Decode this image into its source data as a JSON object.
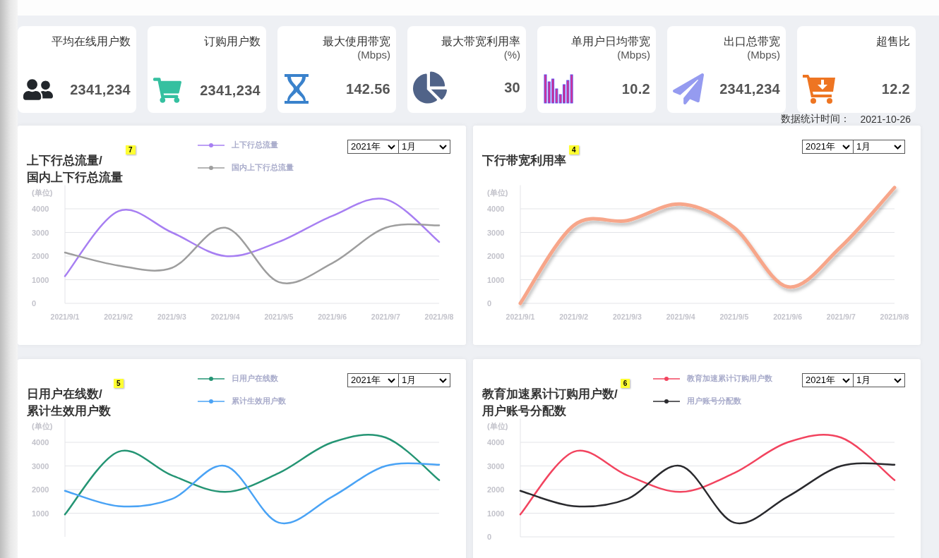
{
  "stats": [
    {
      "title": "平均在线用户数",
      "value": "2341,234"
    },
    {
      "title": "订购用户数",
      "value": "2341,234"
    },
    {
      "title": "最大使用带宽",
      "unit": "(Mbps)",
      "value": "142.56"
    },
    {
      "title": "最大带宽利用率",
      "unit": "(%)",
      "value": "30"
    },
    {
      "title": "单用户日均带宽",
      "unit": "(Mbps)",
      "value": "10.2"
    },
    {
      "title": "出口总带宽",
      "unit": "(Mbps)",
      "value": "2341,234"
    },
    {
      "title": "超售比",
      "value": "12.2"
    }
  ],
  "stat_time": {
    "label": "数据统计时间：",
    "value": "2021-10-26"
  },
  "charts": [
    {
      "title": [
        "上下行总流量/",
        "国内上下行总流量"
      ],
      "badge": "7",
      "year": "2021年",
      "month": "1月",
      "unit": "(单位)",
      "chart_data": {
        "type": "line",
        "grid": true,
        "categories": [
          "2021/9/1",
          "2021/9/2",
          "2021/9/3",
          "2021/9/4",
          "2021/9/5",
          "2021/9/6",
          "2021/9/7",
          "2021/9/8"
        ],
        "ylim": [
          0,
          5000
        ],
        "yticks": [
          0,
          1000,
          2000,
          3000,
          4000
        ],
        "series": [
          {
            "name": "上下行总流量",
            "color": "#a77ff2",
            "values": [
              1150,
              3900,
              3000,
              2000,
              2600,
              3700,
              4400,
              2600
            ]
          },
          {
            "name": "国内上下行总流量",
            "color": "#9e9e9e",
            "values": [
              2150,
              1600,
              1500,
              3200,
              900,
              1700,
              3200,
              3300
            ]
          }
        ]
      }
    },
    {
      "title": [
        "下行带宽利用率"
      ],
      "badge": "4",
      "year": "2021年",
      "month": "1月",
      "unit": "(单位)",
      "chart_data": {
        "type": "line",
        "grid": true,
        "categories": [
          "2021/9/1",
          "2021/9/2",
          "2021/9/3",
          "2021/9/4",
          "2021/9/5",
          "2021/9/6",
          "2021/9/7",
          "2021/9/8"
        ],
        "ylim": [
          0,
          5000
        ],
        "yticks": [
          0,
          1000,
          2000,
          3000,
          4000
        ],
        "series": [
          {
            "color": "#f7a68a",
            "values": [
              0,
              3300,
              3500,
              4200,
              3200,
              700,
              2400,
              4900
            ]
          }
        ]
      }
    },
    {
      "title": [
        "日用户在线数/",
        "累计生效用户数"
      ],
      "badge": "5",
      "year": "2021年",
      "month": "1月",
      "unit": "(单位)",
      "chart_data": {
        "type": "line",
        "grid": true,
        "ylim": [
          0,
          5000
        ],
        "yticks": [
          1000,
          2000,
          3000,
          4000
        ],
        "series": [
          {
            "name": "日用户在线数",
            "color": "#259574",
            "values": [
              950,
              3600,
              2600,
              1900,
              2700,
              4000,
              4200,
              2400
            ]
          },
          {
            "name": "累计生效用户数",
            "color": "#4aa3f5",
            "values": [
              1950,
              1300,
              1600,
              3000,
              600,
              1700,
              3000,
              3050
            ]
          }
        ]
      }
    },
    {
      "title": [
        "教育加速累计订购用户数/",
        "用户账号分配数"
      ],
      "badge": "6",
      "year": "2021年",
      "month": "1月",
      "unit": "(单位)",
      "chart_data": {
        "type": "line",
        "grid": true,
        "ylim": [
          0,
          5000
        ],
        "yticks": [
          0,
          1000,
          2000,
          3000,
          4000
        ],
        "series": [
          {
            "name": "教育加速累计订购用户数",
            "color": "#f2445f",
            "values": [
              950,
              3600,
              2600,
              1900,
              2700,
              4000,
              4200,
              2400
            ]
          },
          {
            "name": "用户账号分配数",
            "color": "#2a2a2e",
            "values": [
              1950,
              1300,
              1600,
              3000,
              600,
              1700,
              3000,
              3050
            ]
          }
        ]
      }
    }
  ]
}
